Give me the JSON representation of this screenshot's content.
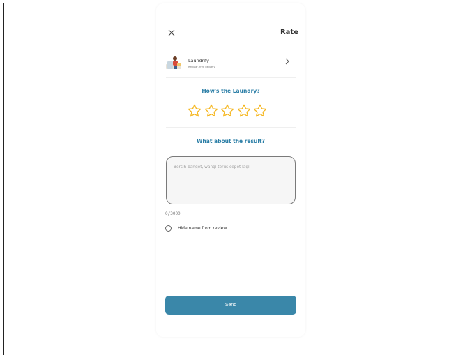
{
  "header": {
    "title": "Rate",
    "close_icon": "close-icon"
  },
  "product": {
    "name": "Laundrify",
    "subtitle": "Regular, free delivery",
    "thumbnail": "laundry-person-illustration",
    "chevron_icon": "chevron-right-icon"
  },
  "rating": {
    "question": "How's the Laundry?",
    "stars_total": 5,
    "stars_selected": 0,
    "star_color": "#f5b51b"
  },
  "review": {
    "question": "What about the result?",
    "placeholder": "Bersih banget, wangi terus cepet lagi",
    "counter": "0/3000"
  },
  "options": {
    "hide_name_label": "Hide name from review",
    "hide_name_checked": false
  },
  "actions": {
    "send_label": "Send"
  },
  "colors": {
    "accent": "#2b7ea6",
    "button": "#3a87a9"
  }
}
